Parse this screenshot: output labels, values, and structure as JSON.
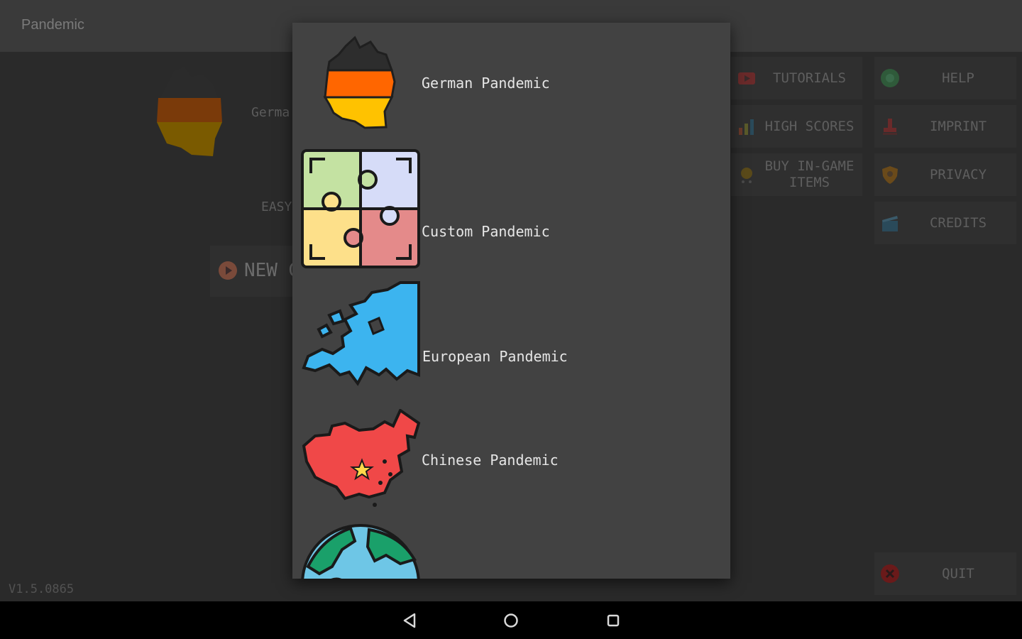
{
  "app": {
    "title": "Pandemic",
    "version": "V1.5.0865"
  },
  "background": {
    "scenario_name_partial": "Germa",
    "difficulty_partial": "EASY",
    "new_game_partial": "NEW G"
  },
  "menu": {
    "tutorials": "TUTORIALS",
    "help": "HELP",
    "high_scores": "HIGH SCORES",
    "imprint": "IMPRINT",
    "buy_items": "BUY IN-GAME ITEMS",
    "privacy": "PRIVACY",
    "credits": "CREDITS",
    "quit": "QUIT"
  },
  "dialog": {
    "options": [
      {
        "label": "German Pandemic",
        "icon": "germany-flag-map-icon"
      },
      {
        "label": "Custom Pandemic",
        "icon": "puzzle-icon"
      },
      {
        "label": "European Pandemic",
        "icon": "europe-map-icon"
      },
      {
        "label": "Chinese Pandemic",
        "icon": "china-map-icon"
      },
      {
        "label": "",
        "icon": "globe-icon"
      }
    ]
  },
  "navbar": {
    "back": "back-icon",
    "home": "home-icon",
    "recents": "recents-icon"
  },
  "colors": {
    "dialog_bg": "#424242",
    "screen_bg": "#2a2a2a",
    "germany": [
      "#2b2b2b",
      "#ff6600",
      "#ffc200"
    ],
    "europe": "#3cb4ef",
    "china": "#f04848",
    "puzzle": [
      "#c4e2a2",
      "#d6dcf8",
      "#fde08a",
      "#e48a8a"
    ]
  }
}
